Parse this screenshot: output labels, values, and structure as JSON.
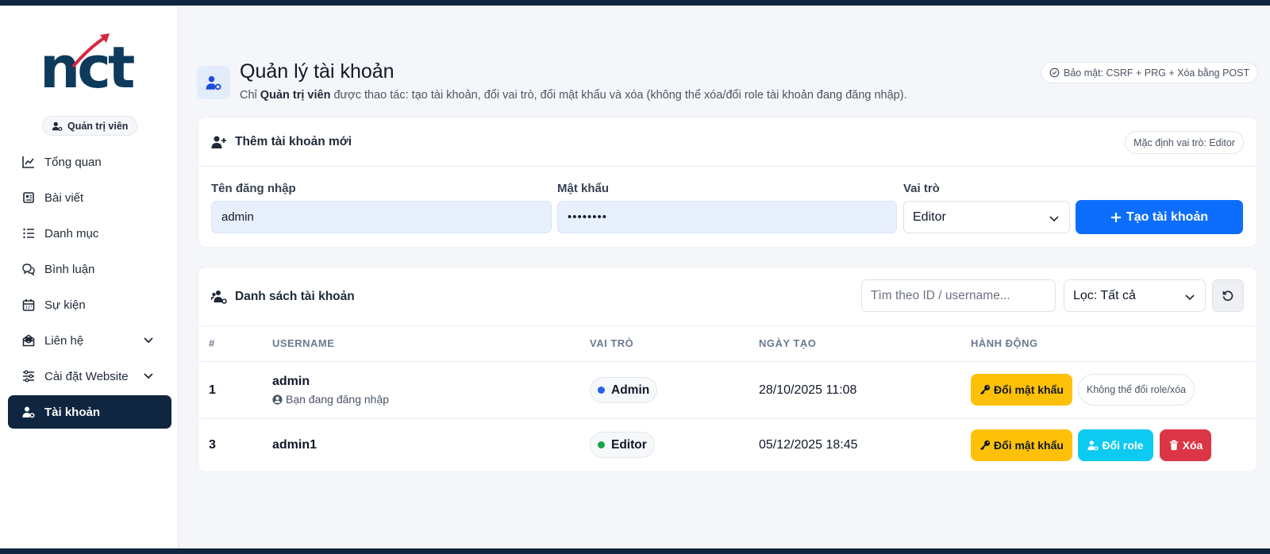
{
  "sidebar": {
    "brand_text": "nct",
    "role_badge": "Quản trị viên",
    "items": [
      {
        "label": "Tổng quan",
        "icon": "chart-line-icon"
      },
      {
        "label": "Bài viết",
        "icon": "newspaper-icon"
      },
      {
        "label": "Danh mục",
        "icon": "list-icon"
      },
      {
        "label": "Bình luận",
        "icon": "comments-icon"
      },
      {
        "label": "Sự kiện",
        "icon": "calendar-icon"
      },
      {
        "label": "Liên hệ",
        "icon": "envelope-open-icon"
      },
      {
        "label": "Cài đặt Website",
        "icon": "sliders-icon"
      },
      {
        "label": "Tài khoản",
        "icon": "user-gear-icon",
        "active": true
      }
    ]
  },
  "header": {
    "title": "Quản lý tài khoản",
    "subtitle_prefix": "Chỉ ",
    "subtitle_bold": "Quản trị viên",
    "subtitle_rest": " được thao tác: tạo tài khoản, đổi vai trò, đổi mật khẩu và xóa (không thể xóa/đổi role tài khoản đang đăng nhập).",
    "security_badge": "Bảo mật: CSRF + PRG + Xóa bằng POST"
  },
  "create_form": {
    "title": "Thêm tài khoản mới",
    "default_role_note": "Mặc định vai trò: Editor",
    "username_label": "Tên đăng nhập",
    "username_value": "admin",
    "password_label": "Mật khẩu",
    "password_value": "••••••••",
    "role_label": "Vai trò",
    "role_value": "Editor",
    "submit_label": "Tạo tài khoản"
  },
  "accounts": {
    "title": "Danh sách tài khoản",
    "search_placeholder": "Tìm theo ID / username...",
    "filter_value": "Lọc: Tất cả",
    "columns": [
      "#",
      "USERNAME",
      "VAI TRÒ",
      "NGÀY TẠO",
      "HÀNH ĐỘNG"
    ],
    "rows": [
      {
        "id": "1",
        "username": "admin",
        "note": "Bạn đang đăng nhập",
        "role": "Admin",
        "role_color": "#2563eb",
        "created": "28/10/2025 11:08",
        "change_password": "Đổi mật khẩu",
        "locked_note": "Không thể đổi role/xóa"
      },
      {
        "id": "3",
        "username": "admin1",
        "role": "Editor",
        "role_color": "#16a34a",
        "created": "05/12/2025 18:45",
        "change_password": "Đổi mật khẩu",
        "change_role": "Đổi role",
        "delete": "Xóa"
      }
    ]
  },
  "colors": {
    "primary": "#0d6efd",
    "navy": "#0f2540",
    "warning": "#ffc107",
    "info": "#0dcaf0",
    "danger": "#dc3545"
  }
}
